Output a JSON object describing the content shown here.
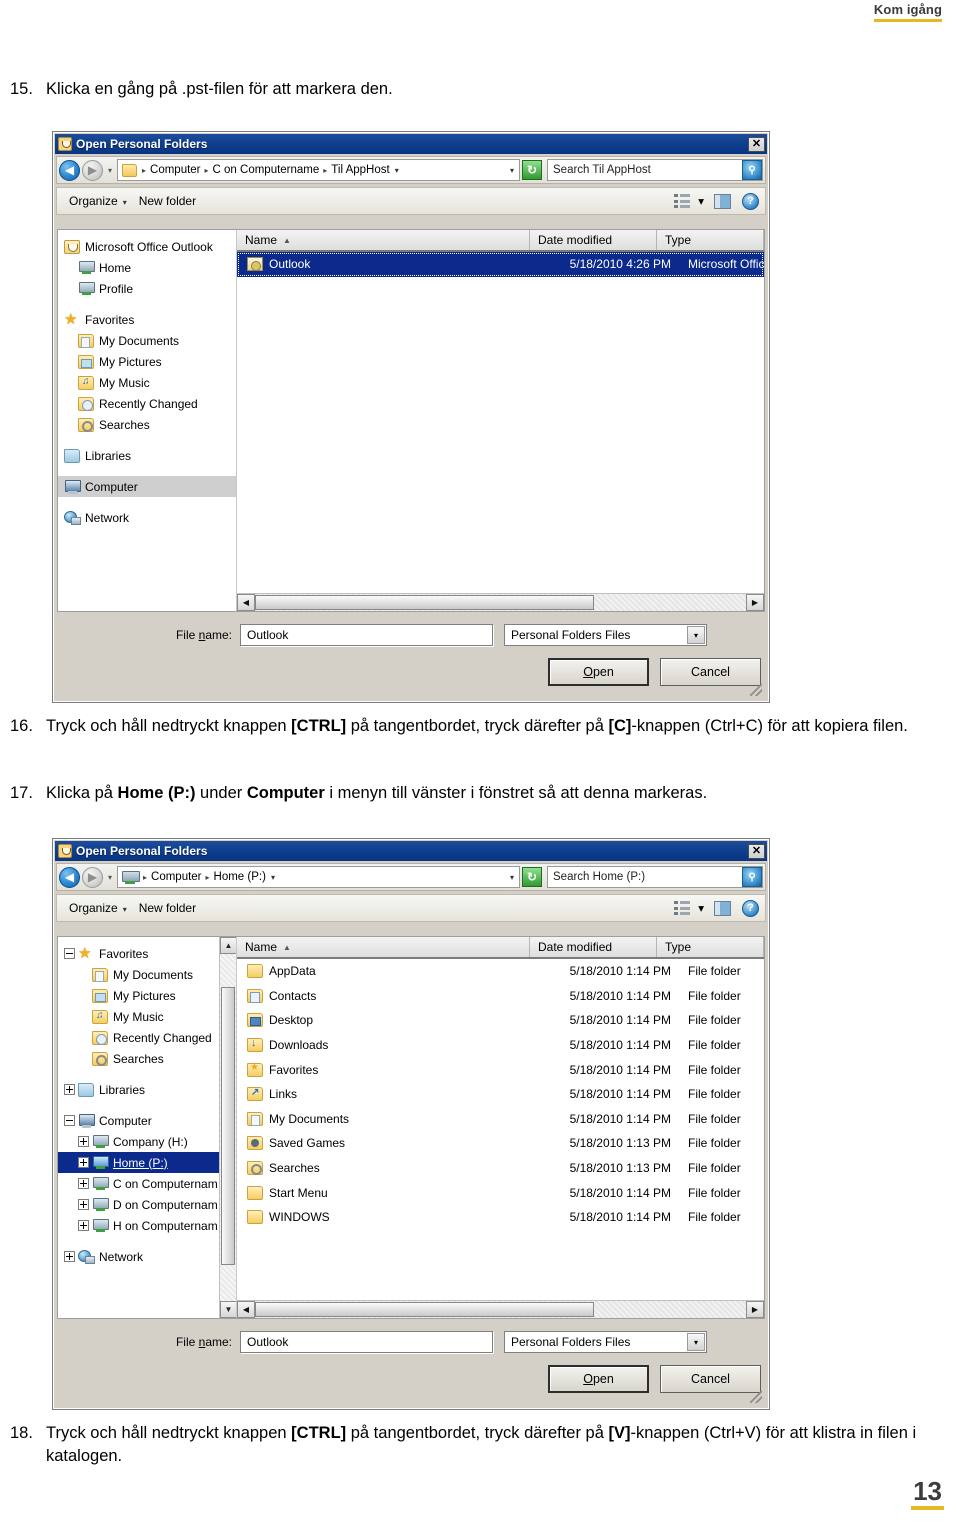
{
  "document": {
    "running_head": "Kom igång",
    "page_number": "13"
  },
  "steps": [
    {
      "num": "15.",
      "parts": [
        {
          "text": "Klicka en gång på .pst-filen för att markera den.",
          "bold": false
        }
      ]
    },
    {
      "num": "16.",
      "parts": [
        {
          "text": "Tryck och håll nedtryckt knappen ",
          "bold": false
        },
        {
          "text": "[CTRL]",
          "bold": true
        },
        {
          "text": " på tangentbordet, tryck därefter på ",
          "bold": false
        },
        {
          "text": "[C]",
          "bold": true
        },
        {
          "text": "-knappen (Ctrl+C) för att kopiera filen.",
          "bold": false
        }
      ]
    },
    {
      "num": "17.",
      "parts": [
        {
          "text": "Klicka på ",
          "bold": false
        },
        {
          "text": "Home (P:)",
          "bold": true
        },
        {
          "text": " under ",
          "bold": false
        },
        {
          "text": "Computer",
          "bold": true
        },
        {
          "text": " i menyn till vänster i fönstret så att denna markeras.",
          "bold": false
        }
      ]
    },
    {
      "num": "18.",
      "parts": [
        {
          "text": "Tryck och håll nedtryckt knappen ",
          "bold": false
        },
        {
          "text": "[CTRL]",
          "bold": true
        },
        {
          "text": " på tangentbordet, tryck därefter på ",
          "bold": false
        },
        {
          "text": "[V]",
          "bold": true
        },
        {
          "text": "-knappen (Ctrl+V) för att klistra in filen i katalogen.",
          "bold": false
        }
      ]
    }
  ],
  "dialog1": {
    "title": "Open Personal Folders",
    "close_label": "✕",
    "nav": {
      "back_glyph": "◀",
      "forward_glyph": "▶",
      "history_glyph": "▾",
      "address_icon": "folder-icon",
      "breadcrumbs": [
        "Computer",
        "C on Computername",
        "Til AppHost"
      ],
      "breadcrumb_caret": "▾",
      "extra_caret": "▾",
      "refresh_glyph": "↻",
      "search_placeholder": "Search Til AppHost",
      "search_icon_glyph": "⚲"
    },
    "commands": {
      "organize": "Organize",
      "new_folder": "New folder",
      "caret": "▾"
    },
    "tree": [
      {
        "label": "Microsoft Office Outlook",
        "icon": "outlook-icon",
        "indent": 0,
        "expander": "none",
        "state": "normal"
      },
      {
        "label": "Home",
        "icon": "drive-icon",
        "indent": 1,
        "expander": "none",
        "state": "normal"
      },
      {
        "label": "Profile",
        "icon": "drive-icon",
        "indent": 1,
        "expander": "none",
        "state": "normal"
      },
      {
        "label": "",
        "icon": "spacer",
        "indent": 0,
        "expander": "none",
        "state": "spacer"
      },
      {
        "label": "Favorites",
        "icon": "star-icon",
        "indent": 0,
        "expander": "none",
        "state": "normal"
      },
      {
        "label": "My Documents",
        "icon": "folder-documents-icon",
        "indent": 1,
        "expander": "none",
        "state": "normal"
      },
      {
        "label": "My Pictures",
        "icon": "folder-pictures-icon",
        "indent": 1,
        "expander": "none",
        "state": "normal"
      },
      {
        "label": "My Music",
        "icon": "folder-music-icon",
        "indent": 1,
        "expander": "none",
        "state": "normal"
      },
      {
        "label": "Recently Changed",
        "icon": "folder-recent-icon",
        "indent": 1,
        "expander": "none",
        "state": "normal"
      },
      {
        "label": "Searches",
        "icon": "folder-search-icon",
        "indent": 1,
        "expander": "none",
        "state": "normal"
      },
      {
        "label": "",
        "icon": "spacer",
        "indent": 0,
        "expander": "none",
        "state": "spacer"
      },
      {
        "label": "Libraries",
        "icon": "libraries-icon",
        "indent": 0,
        "expander": "none",
        "state": "normal"
      },
      {
        "label": "",
        "icon": "spacer",
        "indent": 0,
        "expander": "none",
        "state": "spacer"
      },
      {
        "label": "Computer",
        "icon": "computer-icon",
        "indent": 0,
        "expander": "none",
        "state": "selected"
      },
      {
        "label": "",
        "icon": "spacer",
        "indent": 0,
        "expander": "none",
        "state": "spacer"
      },
      {
        "label": "Network",
        "icon": "network-icon",
        "indent": 0,
        "expander": "none",
        "state": "normal"
      }
    ],
    "columns": [
      {
        "label": "Name",
        "sorted": true,
        "sort_glyph": "▲"
      },
      {
        "label": "Date modified",
        "sorted": false,
        "sort_glyph": ""
      },
      {
        "label": "Type",
        "sorted": false,
        "sort_glyph": ""
      }
    ],
    "files": [
      {
        "name": "Outlook",
        "date": "5/18/2010 4:26 PM",
        "type": "Microsoft Office",
        "icon": "pst-file-icon",
        "selected": true
      }
    ],
    "footer": {
      "file_name_label": "File name:",
      "file_name_label_underline": "n",
      "file_name_value": "Outlook",
      "filter_value": "Personal Folders Files",
      "filter_caret": "▾",
      "open_button": "Open",
      "open_button_underline": "O",
      "cancel_button": "Cancel"
    },
    "scrollbars": {
      "h_left_glyph": "◀",
      "h_right_glyph": "▶",
      "v_up_glyph": "▲",
      "v_down_glyph": "▼"
    }
  },
  "dialog2": {
    "title": "Open Personal Folders",
    "close_label": "✕",
    "nav": {
      "back_glyph": "◀",
      "forward_glyph": "▶",
      "history_glyph": "▾",
      "address_icon": "drive-icon",
      "breadcrumbs": [
        "Computer",
        "Home (P:)"
      ],
      "breadcrumb_caret": "▾",
      "extra_caret": "▾",
      "refresh_glyph": "↻",
      "search_placeholder": "Search Home (P:)",
      "search_icon_glyph": "⚲"
    },
    "commands": {
      "organize": "Organize",
      "new_folder": "New folder",
      "caret": "▾"
    },
    "tree": [
      {
        "label": "Favorites",
        "icon": "star-icon",
        "indent": 0,
        "expander": "minus",
        "state": "normal"
      },
      {
        "label": "My Documents",
        "icon": "folder-documents-icon",
        "indent": 1,
        "expander": "none",
        "state": "normal"
      },
      {
        "label": "My Pictures",
        "icon": "folder-pictures-icon",
        "indent": 1,
        "expander": "none",
        "state": "normal"
      },
      {
        "label": "My Music",
        "icon": "folder-music-icon",
        "indent": 1,
        "expander": "none",
        "state": "normal"
      },
      {
        "label": "Recently Changed",
        "icon": "folder-recent-icon",
        "indent": 1,
        "expander": "none",
        "state": "normal"
      },
      {
        "label": "Searches",
        "icon": "folder-search-icon",
        "indent": 1,
        "expander": "none",
        "state": "normal"
      },
      {
        "label": "",
        "icon": "spacer",
        "indent": 0,
        "expander": "none",
        "state": "spacer"
      },
      {
        "label": "Libraries",
        "icon": "libraries-icon",
        "indent": 0,
        "expander": "plus",
        "state": "normal"
      },
      {
        "label": "",
        "icon": "spacer",
        "indent": 0,
        "expander": "none",
        "state": "spacer"
      },
      {
        "label": "Computer",
        "icon": "computer-icon",
        "indent": 0,
        "expander": "minus",
        "state": "normal"
      },
      {
        "label": "Company (H:)",
        "icon": "drive-icon",
        "indent": 1,
        "expander": "plus",
        "state": "normal"
      },
      {
        "label": "Home (P:)",
        "icon": "drive-blue-icon",
        "indent": 1,
        "expander": "plus",
        "state": "selected-blue"
      },
      {
        "label": "C on Computernam",
        "icon": "drive-icon",
        "indent": 1,
        "expander": "plus",
        "state": "normal"
      },
      {
        "label": "D on Computernam",
        "icon": "drive-icon",
        "indent": 1,
        "expander": "plus",
        "state": "normal"
      },
      {
        "label": "H on Computernam",
        "icon": "drive-icon",
        "indent": 1,
        "expander": "plus",
        "state": "normal"
      },
      {
        "label": "",
        "icon": "spacer",
        "indent": 0,
        "expander": "none",
        "state": "spacer"
      },
      {
        "label": "Network",
        "icon": "network-icon",
        "indent": 0,
        "expander": "plus",
        "state": "normal"
      }
    ],
    "columns": [
      {
        "label": "Name",
        "sorted": true,
        "sort_glyph": "▲"
      },
      {
        "label": "Date modified",
        "sorted": false,
        "sort_glyph": ""
      },
      {
        "label": "Type",
        "sorted": false,
        "sort_glyph": ""
      }
    ],
    "files": [
      {
        "name": "AppData",
        "date": "5/18/2010 1:14 PM",
        "type": "File folder",
        "icon": "folder-icon",
        "selected": false
      },
      {
        "name": "Contacts",
        "date": "5/18/2010 1:14 PM",
        "type": "File folder",
        "icon": "folder-contacts-icon",
        "selected": false
      },
      {
        "name": "Desktop",
        "date": "5/18/2010 1:14 PM",
        "type": "File folder",
        "icon": "folder-desktop-icon",
        "selected": false
      },
      {
        "name": "Downloads",
        "date": "5/18/2010 1:14 PM",
        "type": "File folder",
        "icon": "folder-downloads-icon",
        "selected": false
      },
      {
        "name": "Favorites",
        "date": "5/18/2010 1:14 PM",
        "type": "File folder",
        "icon": "folder-favorites-icon",
        "selected": false
      },
      {
        "name": "Links",
        "date": "5/18/2010 1:14 PM",
        "type": "File folder",
        "icon": "folder-links-icon",
        "selected": false
      },
      {
        "name": "My Documents",
        "date": "5/18/2010 1:14 PM",
        "type": "File folder",
        "icon": "folder-documents-icon",
        "selected": false
      },
      {
        "name": "Saved Games",
        "date": "5/18/2010 1:13 PM",
        "type": "File folder",
        "icon": "folder-games-icon",
        "selected": false
      },
      {
        "name": "Searches",
        "date": "5/18/2010 1:13 PM",
        "type": "File folder",
        "icon": "folder-search-icon",
        "selected": false
      },
      {
        "name": "Start Menu",
        "date": "5/18/2010 1:14 PM",
        "type": "File folder",
        "icon": "folder-icon",
        "selected": false
      },
      {
        "name": "WINDOWS",
        "date": "5/18/2010 1:14 PM",
        "type": "File folder",
        "icon": "folder-icon",
        "selected": false
      }
    ],
    "footer": {
      "file_name_label": "File name:",
      "file_name_label_underline": "n",
      "file_name_value": "Outlook",
      "filter_value": "Personal Folders Files",
      "filter_caret": "▾",
      "open_button": "Open",
      "open_button_underline": "O",
      "cancel_button": "Cancel"
    },
    "scrollbars": {
      "h_left_glyph": "◀",
      "h_right_glyph": "▶",
      "v_up_glyph": "▲",
      "v_down_glyph": "▼"
    }
  },
  "colors": {
    "titlebar": "#0f3f8f",
    "selection": "#0b2a8c",
    "accent_underline": "#e8b820",
    "dialog_face": "#d4d0c8"
  }
}
